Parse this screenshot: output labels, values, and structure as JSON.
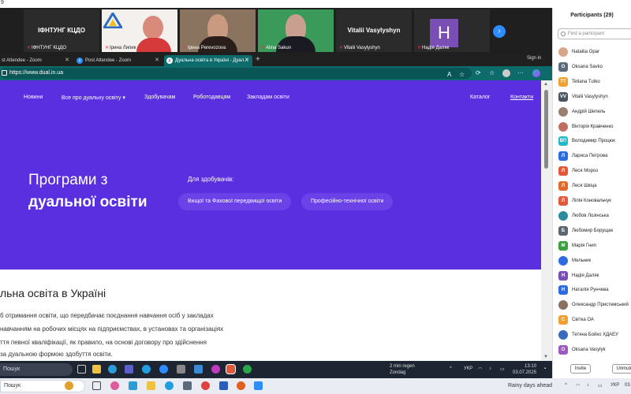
{
  "window_top_text": "9",
  "zoom": {
    "tiles": [
      {
        "type": "text",
        "name": "ІФНТУНГ КЦДО",
        "caption": "ІФНТУНГ КЦДО"
      },
      {
        "type": "logo",
        "caption": "Ірина Липик"
      },
      {
        "type": "video",
        "caption": "Ірина Perevozova"
      },
      {
        "type": "video",
        "caption": "Alina Sakun"
      },
      {
        "type": "text",
        "name": "Vitalii Vasylyshyn",
        "caption": "Vitalii Vasylyshyn"
      },
      {
        "type": "avatar",
        "letter": "H",
        "caption": "Надія Даляк"
      }
    ],
    "next_icon": "chevron-right-icon"
  },
  "browser": {
    "tabs": [
      {
        "label": "st Attendee - Zoom"
      },
      {
        "label": "Post Attendee - Zoom"
      },
      {
        "label": "Дуальна освіта в Україні - Дуал..."
      }
    ],
    "sign_in": "Sign in",
    "url": "https://www.dual.in.ua"
  },
  "site": {
    "nav": [
      "Новини",
      "Все про дуальну освіту",
      "Здобувачам",
      "Роботодавцям",
      "Закладам освіти"
    ],
    "nav_right": [
      "Каталог",
      "Контакти"
    ],
    "hero_line1": "Програми з",
    "hero_line2": "дуальної освіти",
    "hero_label": "Для здобувачів:",
    "pills": [
      "Вищої та Фахової передвищої освіти",
      "Професійно-технічної освіти"
    ],
    "section_title": "льна освіта в Україні",
    "paragraph": [
      "б отримання освіти, що передбачає поєднання навчання осіб у закладах",
      "навчанням на робочих місцях на підприємствах, в установах та організаціях",
      "ття певної кваліфікації, як правило, на основі договору про здійснення",
      "за дуальною формою здобуття освіти."
    ]
  },
  "taskbar_inner": {
    "search": "Пошук",
    "weather_line1": "2 min regen",
    "weather_line2": "Zondag",
    "lang": "УКР",
    "time": "13:10",
    "date": "03.07.2025"
  },
  "taskbar_outer": {
    "search": "Пошук",
    "weather": "Rainy days ahead",
    "lang": "УКР",
    "date_short": "03"
  },
  "participants": {
    "title": "Participants (29)",
    "find_placeholder": "Find a participant",
    "list": [
      {
        "name": "Nataliia Opar",
        "initials": "",
        "color": "#d9a58a",
        "photo": true
      },
      {
        "name": "Oksana Savko",
        "initials": "O",
        "color": "#5c6b7a",
        "photo": false
      },
      {
        "name": "Tetiana Tutko",
        "initials": "TT",
        "color": "#f0a030",
        "photo": false
      },
      {
        "name": "Vitalii Vasylyshyn",
        "initials": "VV",
        "color": "#4a5560",
        "photo": false
      },
      {
        "name": "Андрій Шепель",
        "initials": "",
        "color": "#9a8070",
        "photo": true
      },
      {
        "name": "Вікторія Кравченко",
        "initials": "",
        "color": "#c07060",
        "photo": true
      },
      {
        "name": "Володимир Процюк",
        "initials": "ВП",
        "color": "#22b8c8",
        "photo": false
      },
      {
        "name": "Лариса Петрова",
        "initials": "Л",
        "color": "#2d6be0",
        "photo": false
      },
      {
        "name": "Леся Мороз",
        "initials": "Л",
        "color": "#e05a3a",
        "photo": false
      },
      {
        "name": "Леся Шкіца",
        "initials": "Л",
        "color": "#e06a2a",
        "photo": false
      },
      {
        "name": "Лілія Коновальчук",
        "initials": "Л",
        "color": "#e05a3a",
        "photo": false
      },
      {
        "name": "Любов Лозінська",
        "initials": "",
        "color": "#2a8c9c",
        "photo": true
      },
      {
        "name": "Любомир Борущак",
        "initials": "Б",
        "color": "#5c6670",
        "photo": false
      },
      {
        "name": "Марія Гнип",
        "initials": "М",
        "color": "#3aa040",
        "photo": false
      },
      {
        "name": "Мельник",
        "initials": "",
        "color": "#2d6be0",
        "photo": true
      },
      {
        "name": "Надія Даляк",
        "initials": "Н",
        "color": "#7a4fb5",
        "photo": false
      },
      {
        "name": "Наталія Рунчева",
        "initials": "Н",
        "color": "#2d6be0",
        "photo": false
      },
      {
        "name": "Олександр Пристемський",
        "initials": "",
        "color": "#8a7060",
        "photo": true
      },
      {
        "name": "Світка ОА",
        "initials": "С",
        "color": "#f0a030",
        "photo": false
      },
      {
        "name": "Тетяна Бойко ХДАЕУ",
        "initials": "",
        "color": "#3a6ac0",
        "photo": true
      },
      {
        "name": "Oksana Vasylyk",
        "initials": "O",
        "color": "#9a5ac0",
        "photo": false
      }
    ],
    "invite_label": "Invite",
    "unmute_label": "Unmute"
  }
}
